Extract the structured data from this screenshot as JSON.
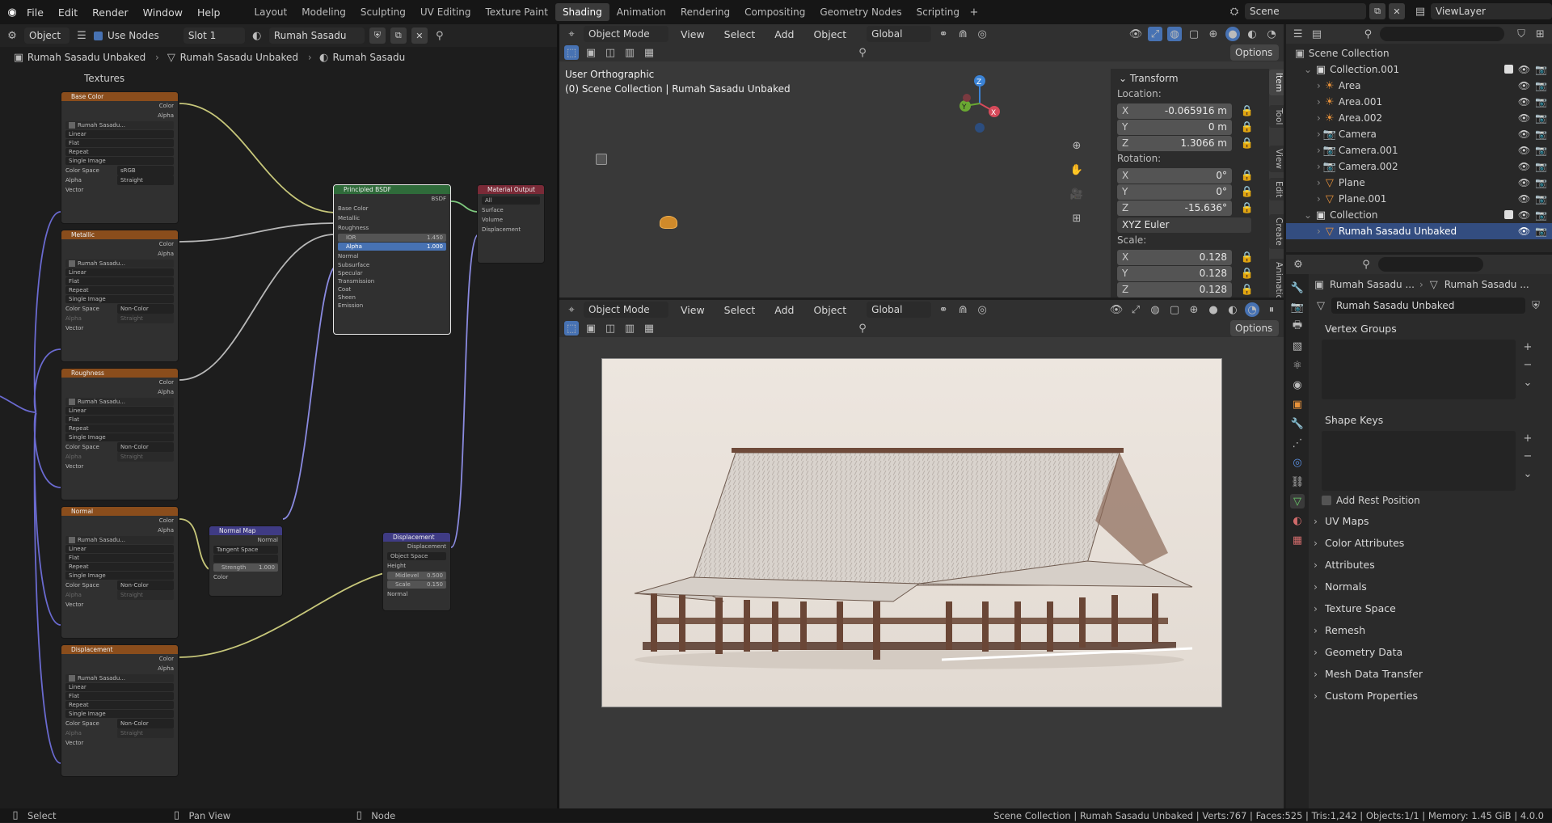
{
  "menu": {
    "file": "File",
    "edit": "Edit",
    "render": "Render",
    "window": "Window",
    "help": "Help"
  },
  "workspaces": [
    "Layout",
    "Modeling",
    "Sculpting",
    "UV Editing",
    "Texture Paint",
    "Shading",
    "Animation",
    "Rendering",
    "Compositing",
    "Geometry Nodes",
    "Scripting"
  ],
  "active_workspace": "Shading",
  "scene": "Scene",
  "view_layer": "ViewLayer",
  "node_editor": {
    "object_mode": "Object",
    "use_nodes": "Use Nodes",
    "slot": "Slot 1",
    "material": "Rumah Sasadu",
    "breadcrumb": [
      "Rumah Sasadu Unbaked",
      "Rumah Sasadu Unbaked",
      "Rumah Sasadu"
    ],
    "frame_label": "Textures",
    "texture_nodes": [
      {
        "title": "Base Color",
        "color_space": "sRGB",
        "alpha": "Straight"
      },
      {
        "title": "Metallic",
        "color_space": "Non-Color",
        "alpha": "Straight"
      },
      {
        "title": "Roughness",
        "color_space": "Non-Color",
        "alpha": "Straight"
      },
      {
        "title": "Normal",
        "color_space": "Non-Color",
        "alpha": "Straight"
      },
      {
        "title": "Displacement",
        "color_space": "Non-Color",
        "alpha": "Straight"
      }
    ],
    "tex_labels": {
      "color": "Color",
      "alpha": "Alpha",
      "image": "Rumah Sasadu...",
      "interp": "Linear",
      "proj": "Flat",
      "ext": "Repeat",
      "src": "Single Image",
      "cs_label": "Color Space",
      "alpha_label": "Alpha",
      "vector": "Vector"
    },
    "bsdf": {
      "title": "Principled BSDF",
      "out": "BSDF",
      "inputs": [
        "Base Color",
        "Metallic",
        "Roughness"
      ],
      "ior_label": "IOR",
      "ior": "1.450",
      "alpha_label": "Alpha",
      "alpha": "1.000",
      "normal": "Normal",
      "subs": [
        "Subsurface",
        "Specular",
        "Transmission",
        "Coat",
        "Sheen",
        "Emission"
      ]
    },
    "output": {
      "title": "Material Output",
      "target": "All",
      "inputs": [
        "Surface",
        "Volume",
        "Displacement"
      ]
    },
    "normal_map": {
      "title": "Normal Map",
      "out": "Normal",
      "space": "Tangent Space",
      "strength_label": "Strength",
      "strength": "1.000",
      "color": "Color"
    },
    "displacement": {
      "title": "Displacement",
      "out": "Displacement",
      "space": "Object Space",
      "height": "Height",
      "midlevel_label": "Midlevel",
      "midlevel": "0.500",
      "scale_label": "Scale",
      "scale": "0.150",
      "normal": "Normal"
    }
  },
  "viewport_top": {
    "mode": "Object Mode",
    "view": "View",
    "select": "Select",
    "add": "Add",
    "object": "Object",
    "orientation": "Global",
    "options": "Options",
    "overlay1": "User Orthographic",
    "overlay2": "(0) Scene Collection | Rumah Sasadu Unbaked",
    "transform": {
      "title": "Transform",
      "location": "Location:",
      "rotation": "Rotation:",
      "scale": "Scale:",
      "euler": "XYZ Euler",
      "loc": [
        {
          "axis": "X",
          "value": "-0.065916 m"
        },
        {
          "axis": "Y",
          "value": "0 m"
        },
        {
          "axis": "Z",
          "value": "1.3066 m"
        }
      ],
      "rot": [
        {
          "axis": "X",
          "value": "0°"
        },
        {
          "axis": "Y",
          "value": "0°"
        },
        {
          "axis": "Z",
          "value": "-15.636°"
        }
      ],
      "scl": [
        {
          "axis": "X",
          "value": "0.128"
        },
        {
          "axis": "Y",
          "value": "0.128"
        },
        {
          "axis": "Z",
          "value": "0.128"
        }
      ]
    },
    "tabs": [
      "Item",
      "Tool",
      "View",
      "Edit",
      "Create",
      "Animation"
    ],
    "gizmo": {
      "x": "X",
      "y": "Y",
      "z": "Z"
    }
  },
  "viewport_bottom": {
    "mode": "Object Mode",
    "view": "View",
    "select": "Select",
    "add": "Add",
    "object": "Object",
    "orientation": "Global",
    "options": "Options"
  },
  "outliner": {
    "root": "Scene Collection",
    "items": [
      {
        "name": "Collection.001",
        "level": 1,
        "type": "collection"
      },
      {
        "name": "Area",
        "level": 2,
        "type": "light"
      },
      {
        "name": "Area.001",
        "level": 2,
        "type": "light"
      },
      {
        "name": "Area.002",
        "level": 2,
        "type": "light"
      },
      {
        "name": "Camera",
        "level": 2,
        "type": "camera"
      },
      {
        "name": "Camera.001",
        "level": 2,
        "type": "camera"
      },
      {
        "name": "Camera.002",
        "level": 2,
        "type": "camera"
      },
      {
        "name": "Plane",
        "level": 2,
        "type": "mesh"
      },
      {
        "name": "Plane.001",
        "level": 2,
        "type": "mesh"
      },
      {
        "name": "Collection",
        "level": 1,
        "type": "collection"
      },
      {
        "name": "Rumah Sasadu Unbaked",
        "level": 2,
        "type": "mesh",
        "selected": true
      }
    ]
  },
  "properties": {
    "breadcrumb1": "Rumah Sasadu ...",
    "breadcrumb2": "Rumah Sasadu ...",
    "mesh_name": "Rumah Sasadu Unbaked",
    "vertex_groups": "Vertex Groups",
    "shape_keys": "Shape Keys",
    "add_rest": "Add Rest Position",
    "sections": [
      "UV Maps",
      "Color Attributes",
      "Attributes",
      "Normals",
      "Texture Space",
      "Remesh",
      "Geometry Data",
      "Mesh Data Transfer",
      "Custom Properties"
    ]
  },
  "statusbar": {
    "select": "Select",
    "pan": "Pan View",
    "node": "Node",
    "info": "Scene Collection | Rumah Sasadu Unbaked | Verts:767 | Faces:525 | Tris:1,242 | Objects:1/1 | Memory: 1.45 GiB | 4.0.0"
  },
  "colors": {
    "accent": "#4772b3",
    "selected_row": "#334d80",
    "tex_header": "#8a4d1c",
    "bsdf_header": "#2f6b3a",
    "output_header": "#7a2a37",
    "vector_header": "#3f3b84"
  }
}
